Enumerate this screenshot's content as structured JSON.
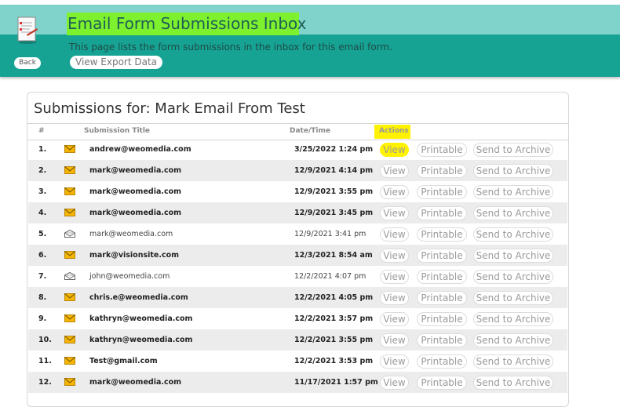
{
  "header": {
    "title": "Email Form Submissions Inbox",
    "description": "This page lists the form submissions in the inbox for this email form.",
    "back_label": "Back",
    "export_label": "View Export Data"
  },
  "panel": {
    "title": "Submissions for: Mark Email From Test",
    "columns": {
      "num": "#",
      "title": "Submission Title",
      "date": "Date/Time",
      "actions": "Actions"
    }
  },
  "actions": {
    "view": "View",
    "printable": "Printable",
    "archive": "Send to Archive"
  },
  "rows": [
    {
      "num": "1.",
      "title": "andrew@weomedia.com",
      "date": "3/25/2022 1:24 pm",
      "unread": true
    },
    {
      "num": "2.",
      "title": "mark@weomedia.com",
      "date": "12/9/2021 4:14 pm",
      "unread": true
    },
    {
      "num": "3.",
      "title": "mark@weomedia.com",
      "date": "12/9/2021 3:55 pm",
      "unread": true
    },
    {
      "num": "4.",
      "title": "mark@weomedia.com",
      "date": "12/9/2021 3:45 pm",
      "unread": true
    },
    {
      "num": "5.",
      "title": "mark@weomedia.com",
      "date": "12/9/2021 3:41 pm",
      "unread": false
    },
    {
      "num": "6.",
      "title": "mark@visionsite.com",
      "date": "12/3/2021 8:54 am",
      "unread": true
    },
    {
      "num": "7.",
      "title": "john@weomedia.com",
      "date": "12/2/2021 4:07 pm",
      "unread": false
    },
    {
      "num": "8.",
      "title": "chris.e@weomedia.com",
      "date": "12/2/2021 4:05 pm",
      "unread": true
    },
    {
      "num": "9.",
      "title": "kathryn@weomedia.com",
      "date": "12/2/2021 3:57 pm",
      "unread": true
    },
    {
      "num": "10.",
      "title": "kathryn@weomedia.com",
      "date": "12/2/2021 3:55 pm",
      "unread": true
    },
    {
      "num": "11.",
      "title": "Test@gmail.com",
      "date": "12/2/2021 3:53 pm",
      "unread": true
    },
    {
      "num": "12.",
      "title": "mark@weomedia.com",
      "date": "11/17/2021 1:57 pm",
      "unread": true
    }
  ]
}
